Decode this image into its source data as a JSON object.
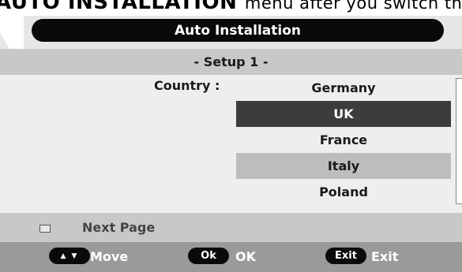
{
  "instruction_text": {
    "bold": "AUTO INSTALLATION",
    "plain": "menu after you switch the"
  },
  "dialog": {
    "title": "Auto Installation",
    "setup_label": "- Setup 1 -",
    "country_label": "Country :",
    "countries": [
      {
        "name": "Germany",
        "state": "normal"
      },
      {
        "name": "UK",
        "state": "selected"
      },
      {
        "name": "France",
        "state": "normal"
      },
      {
        "name": "Italy",
        "state": "highlighted"
      },
      {
        "name": "Poland",
        "state": "normal"
      }
    ],
    "next_page_label": "Next Page"
  },
  "footer": {
    "move_key": "▲ ▼",
    "move_label": "Move",
    "ok_key": "Ok",
    "ok_label": "OK",
    "exit_key": "Exit",
    "exit_label": "Exit"
  },
  "colors": {
    "title_pill": "#0a0a0a",
    "selected_row": "#3c3c3c",
    "highlight_row": "#bdbdbd",
    "footer_bg": "#9a9a9a"
  }
}
